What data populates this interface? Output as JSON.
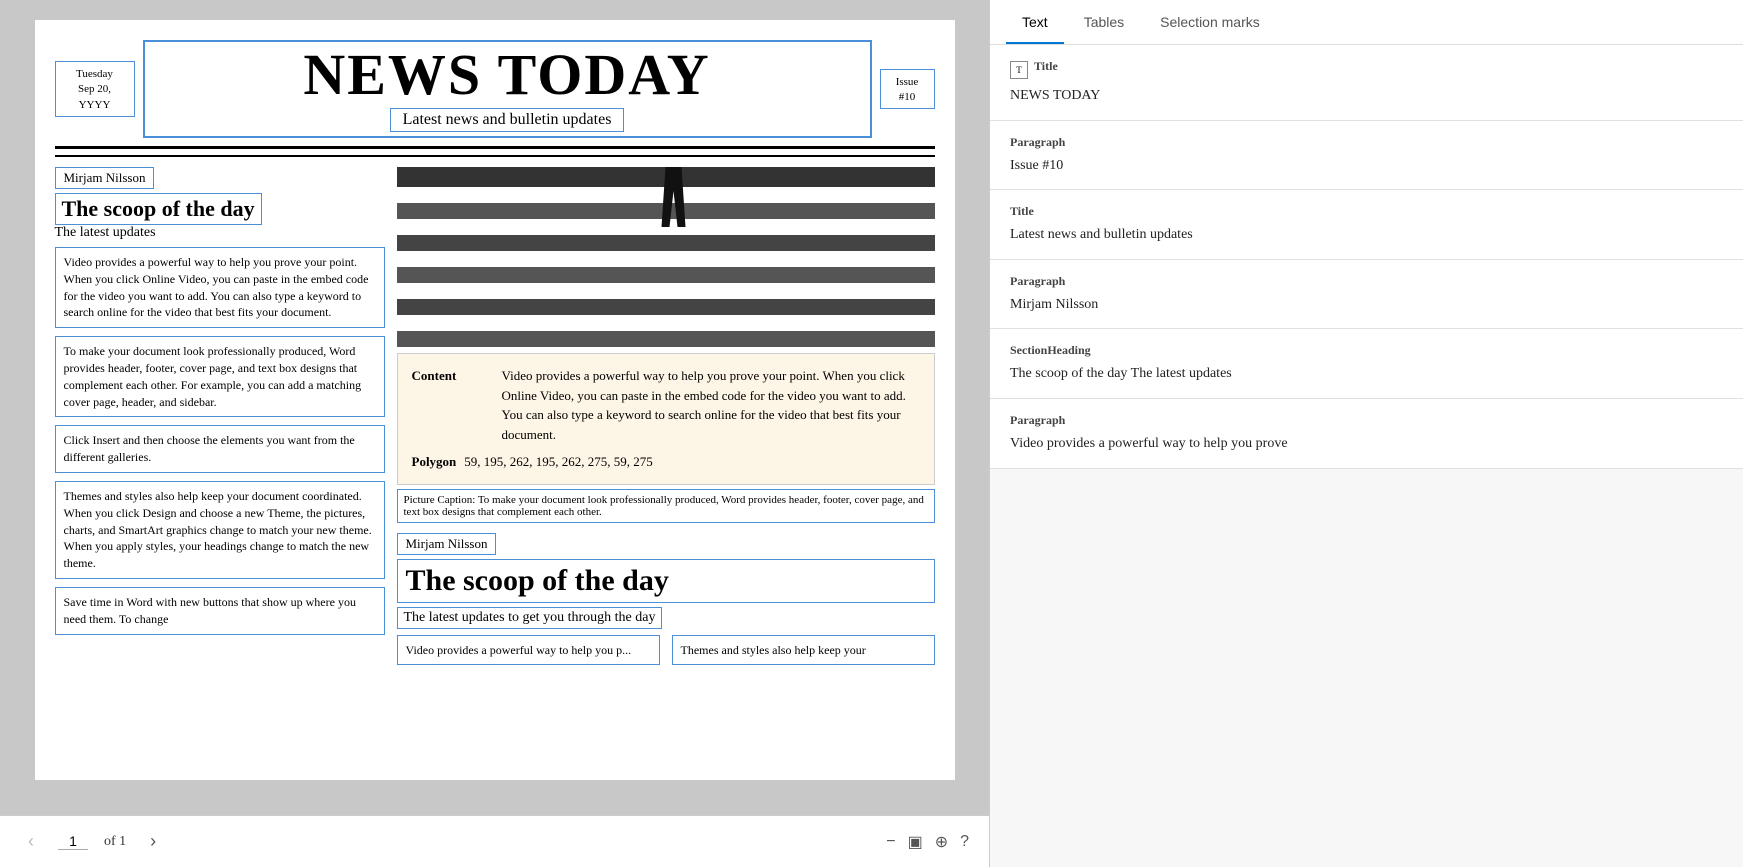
{
  "doc": {
    "newspaper": {
      "date": "Tuesday\nSep 20,\nYYYY",
      "title": "NEWS TODAY",
      "subtitle": "Latest news and bulletin updates",
      "issue": "Issue\n#10"
    },
    "article1": {
      "author": "Mirjam Nilsson",
      "heading": "The scoop of the day",
      "subheading": "The latest updates",
      "para1": "Video provides a powerful way to help you prove your point. When you click Online Video, you can paste in the embed code for the video you want to add. You can also type a keyword to search online for the video that best fits your document.",
      "para2": "To make your document look professionally produced, Word provides header, footer, cover page, and text box designs that complement each other. For example, you can add a matching cover page, header, and sidebar.",
      "para3": "Click Insert and then choose the elements you want from the different galleries.",
      "para4": "Themes and styles also help keep your document coordinated. When you click Design and choose a new Theme, the pictures, charts, and SmartArt graphics change to match your new theme. When you apply styles, your headings change to match the new theme.",
      "para5": "Save time in Word with new buttons that show up where you need them. To change"
    },
    "popup": {
      "content_label": "Content",
      "content_text": "Video provides a powerful way to help you prove your point. When you click Online Video, you can paste in the embed code for the video you want to add. You can also type a keyword to search online for the video that best fits your document.",
      "polygon_label": "Polygon",
      "polygon_values": "59, 195, 262, 195, 262, 275, 59, 275"
    },
    "caption": "Picture Caption: To make your document look professionally produced, Word provides header, footer, cover page, and text box designs that complement each other.",
    "article2": {
      "author": "Mirjam Nilsson",
      "heading": "The scoop of the day",
      "subheading": "The latest updates to get you through the day",
      "para_left": "Video provides a powerful way to help you p...",
      "para_right": "Themes and styles also help keep your"
    }
  },
  "pagination": {
    "current_page": "1",
    "of_label": "of 1",
    "total": "1"
  },
  "right_panel": {
    "tabs": [
      {
        "label": "Text",
        "active": true
      },
      {
        "label": "Tables",
        "active": false
      },
      {
        "label": "Selection marks",
        "active": false
      }
    ],
    "results": [
      {
        "type": "Title",
        "value": "NEWS TODAY"
      },
      {
        "type": "Paragraph",
        "value": "Issue #10"
      },
      {
        "type": "Title",
        "value": "Latest news and bulletin updates"
      },
      {
        "type": "Paragraph",
        "value": "Mirjam Nilsson"
      },
      {
        "type": "SectionHeading",
        "value": "The scoop of the day The latest updates"
      },
      {
        "type": "Paragraph",
        "value": "Video provides a powerful way to help you prove"
      }
    ]
  }
}
